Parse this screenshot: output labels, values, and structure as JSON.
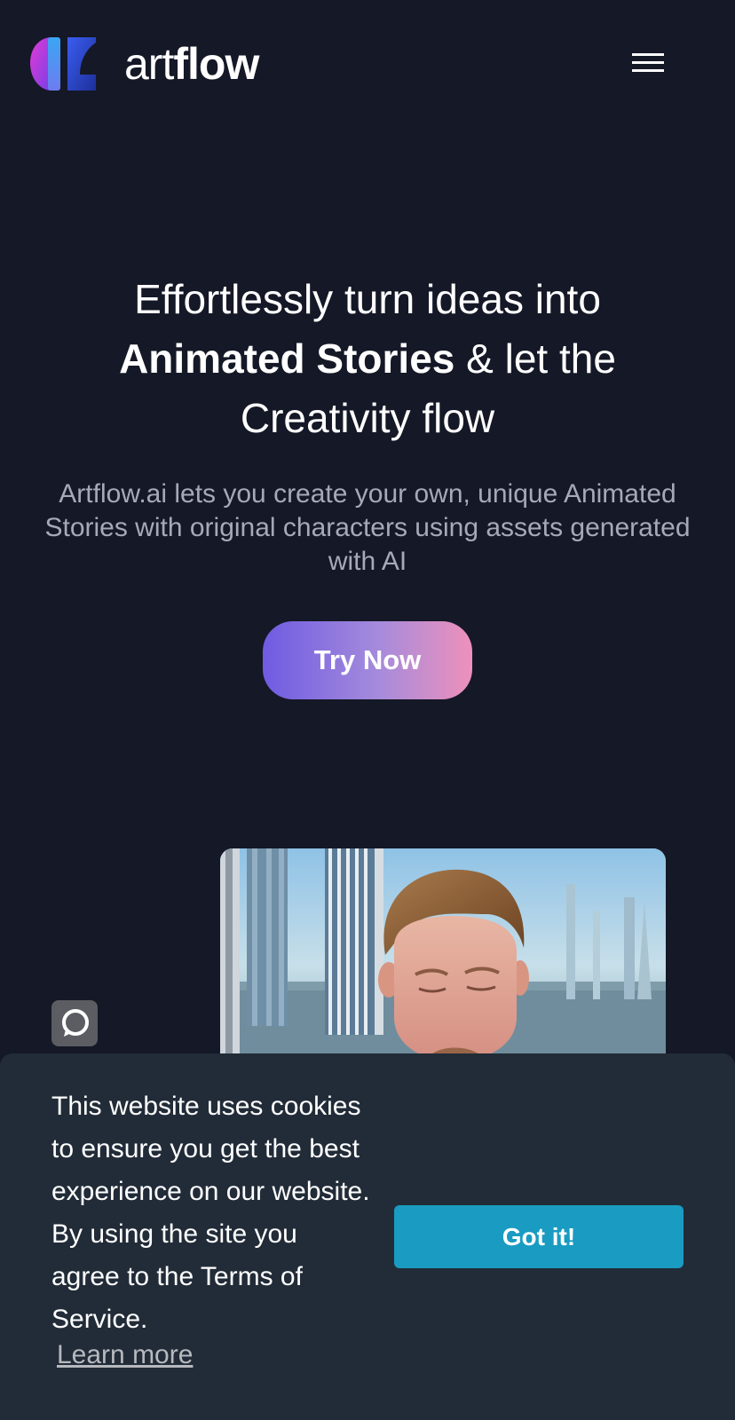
{
  "header": {
    "brand_light": "art",
    "brand_bold": "flow",
    "logo_icon": "artflow-logo",
    "menu_icon": "hamburger-menu-icon"
  },
  "hero": {
    "title_line1": "Effortlessly turn ideas into",
    "title_bold": "Animated Stories",
    "title_after_bold": " & let the",
    "title_line3": "Creativity flow",
    "subtitle": "Artflow.ai lets you create your own, unique Animated Stories with original characters using assets generated with AI",
    "cta_label": "Try Now"
  },
  "preview": {
    "chat_icon": "chat-bubble-icon"
  },
  "cookie_banner": {
    "message": "This website uses cookies to ensure you get the best experience on our website. By using the site you agree to the Terms of Service.",
    "learn_more": "Learn more",
    "accept_label": "Got it!"
  },
  "colors": {
    "background": "#151826",
    "cta_gradient_start": "#6f5be2",
    "cta_gradient_end": "#ee90bb",
    "cookie_background": "#222c38",
    "accept_button": "#1a9bc1",
    "subtitle_text": "#a6a9b7"
  }
}
